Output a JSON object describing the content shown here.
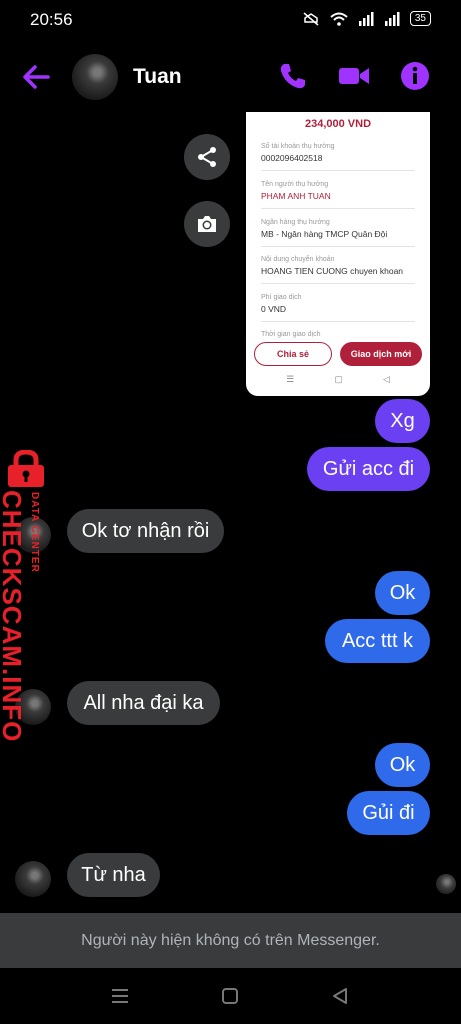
{
  "status": {
    "time": "20:56",
    "battery": "35"
  },
  "header": {
    "contact_name": "Tuan"
  },
  "receipt": {
    "amount": "234,000 VND",
    "fields": [
      {
        "label": "Số tài khoản thụ hưởng",
        "value": "0002096402518"
      },
      {
        "label": "Tên người thụ hưởng",
        "value": "PHAM ANH TUAN"
      },
      {
        "label": "Ngân hàng thụ hưởng",
        "value": "MB - Ngân hàng TMCP Quân Đội"
      },
      {
        "label": "Nội dung chuyển khoản",
        "value": "HOANG TIEN CUONG chuyen khoan"
      },
      {
        "label": "Phí giao dịch",
        "value": "0 VND"
      },
      {
        "label": "Thời gian giao dịch",
        "value": ""
      }
    ],
    "share_label": "Chia sẻ",
    "new_txn_label": "Giao dịch mới"
  },
  "messages": [
    {
      "side": "out",
      "text": "Xg"
    },
    {
      "side": "out",
      "text": "Gửi acc đi"
    },
    {
      "side": "in",
      "text": "Ok tơ nhận rồi"
    },
    {
      "side": "out",
      "text": "Ok"
    },
    {
      "side": "out",
      "text": "Acc ttt k"
    },
    {
      "side": "in",
      "text": "All nha đại ka"
    },
    {
      "side": "out",
      "text": "Ok"
    },
    {
      "side": "out",
      "text": "Gủi đi"
    },
    {
      "side": "in",
      "text": "Từ nha"
    }
  ],
  "watermark": {
    "main": "CHECKSCAM.INFO",
    "sub": "DATA CENTER"
  },
  "footer": {
    "unavailable_text": "Người này hiện không có trên Messenger."
  },
  "colors": {
    "accent": "#a033ff",
    "outgoing_purple": "#6b3ff2",
    "outgoing_blue": "#2e6ae9",
    "incoming": "#3a3b3c",
    "bank_red": "#b0203a"
  },
  "icons": [
    "back-arrow-icon",
    "phone-icon",
    "video-icon",
    "info-icon",
    "share-icon",
    "camera-icon",
    "lock-icon",
    "menu-icon",
    "home-icon",
    "back-icon"
  ]
}
